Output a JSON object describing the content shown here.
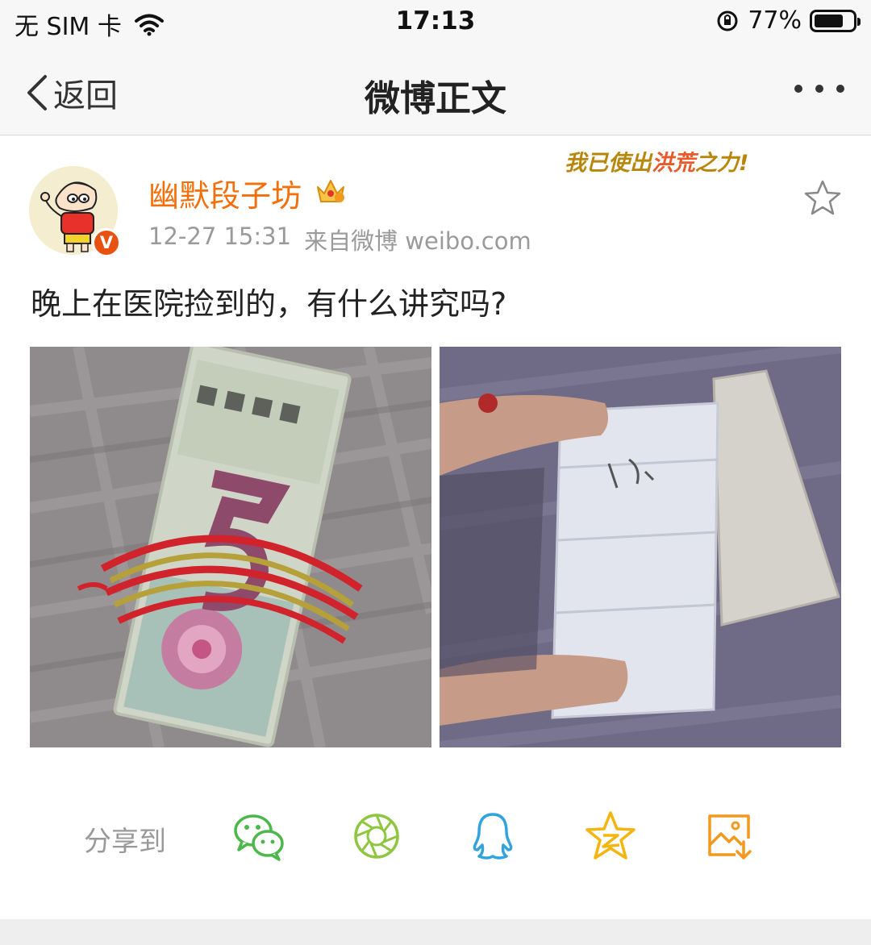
{
  "status_bar": {
    "carrier": "无 SIM 卡",
    "time": "17:13",
    "battery": "77%",
    "battery_level": 0.77
  },
  "nav": {
    "back_label": "返回",
    "title": "微博正文"
  },
  "banner": {
    "part1": "我已使出",
    "part2": "洪荒",
    "part3": "之力!"
  },
  "post": {
    "author": "幽默段子坊",
    "time": "12-27 15:31",
    "source": "来自微博 weibo.com",
    "verified_mark": "V",
    "text": "晚上在医院捡到的，有什么讲究吗?"
  },
  "share": {
    "label": "分享到",
    "targets": [
      "wechat-icon",
      "moments-icon",
      "qq-icon",
      "qzone-icon",
      "save-image-icon"
    ]
  },
  "colors": {
    "author": "#f46f0a",
    "wechat": "#4cb84a",
    "moments": "#8ec63f",
    "qq": "#33a3dc",
    "qzone": "#f4b50f",
    "save": "#f29a1f"
  }
}
